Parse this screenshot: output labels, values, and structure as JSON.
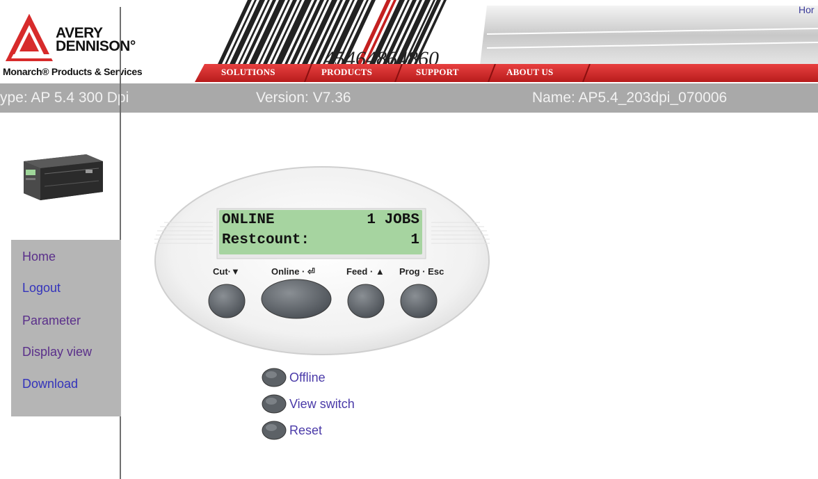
{
  "header": {
    "brand_line1": "AVERY",
    "brand_line2": "DENNISON°",
    "subbrand": "Monarch® Products & Services",
    "barcode_digits": "45464864860",
    "top_link": "Hor",
    "nav": [
      "SOLUTIONS",
      "PRODUCTS",
      "SUPPORT",
      "ABOUT US"
    ],
    "colors": {
      "accent_red": "#d42a2a",
      "info_bar": "#a9a9a9"
    }
  },
  "info": {
    "type": "ype: AP 5.4 300 Dpi",
    "version": "Version: V7.36",
    "name": "Name: AP5.4_203dpi_070006"
  },
  "sidenav": {
    "items": [
      "Home",
      "Logout",
      "Parameter",
      "Display view",
      "Download"
    ]
  },
  "panel": {
    "lcd_line1_left": "ONLINE",
    "lcd_line1_right": "1 JOBS",
    "lcd_line2_left": "Restcount:",
    "lcd_line2_right": "1",
    "buttons": [
      "Cut·▼",
      "Online · ⏎",
      "Feed · ▲",
      "Prog · Esc"
    ]
  },
  "actions": [
    "Offline",
    "View switch",
    "Reset"
  ],
  "icons": [
    "avery-logo-icon",
    "printer-icon",
    "round-button-icon"
  ]
}
